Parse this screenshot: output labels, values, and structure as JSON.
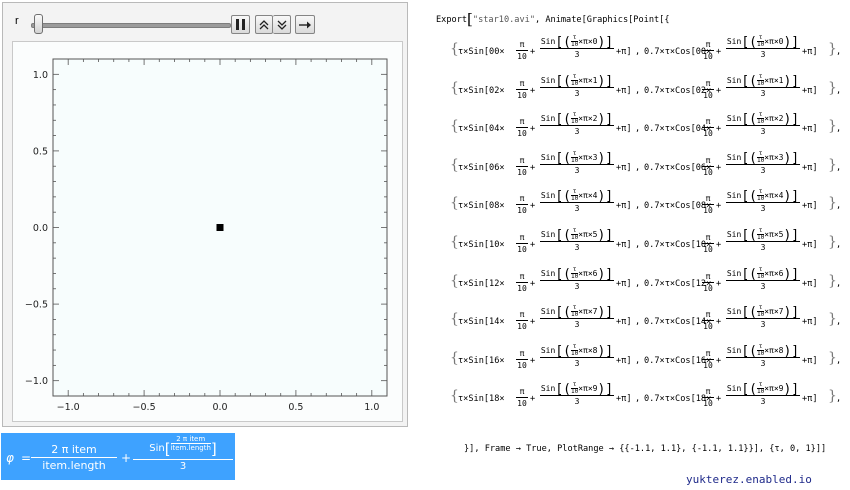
{
  "controls": {
    "label": "r",
    "slider_value": 0,
    "icons": [
      "pause-icon",
      "faster-icon",
      "slower-icon",
      "direction-icon"
    ]
  },
  "plot": {
    "x_ticks": [
      "−1.0",
      "−0.5",
      "0.0",
      "0.5",
      "1.0"
    ],
    "y_ticks": [
      "1.0",
      "0.5",
      "0.0",
      "−0.5",
      "−1.0"
    ],
    "xlim": [
      -1.1,
      1.1
    ],
    "ylim": [
      -1.1,
      1.1
    ],
    "point": [
      0,
      0
    ]
  },
  "phi_formula": {
    "lhs": "φ",
    "eq": "=",
    "num1": "2 π item",
    "den1": "item.length",
    "plus": "+",
    "sin_label": "Sin",
    "inner_num": "2 π item",
    "inner_den": "item.length",
    "den2": "3"
  },
  "code": {
    "head_export": "Export",
    "head_file": "\"star10.avi\"",
    "head_rest": ", Animate[Graphics[Point[{",
    "rows": [
      {
        "k": "00",
        "i": "0"
      },
      {
        "k": "02",
        "i": "1"
      },
      {
        "k": "04",
        "i": "2"
      },
      {
        "k": "06",
        "i": "3"
      },
      {
        "k": "08",
        "i": "4"
      },
      {
        "k": "10",
        "i": "5"
      },
      {
        "k": "12",
        "i": "6"
      },
      {
        "k": "14",
        "i": "7"
      },
      {
        "k": "16",
        "i": "8"
      },
      {
        "k": "18",
        "i": "9"
      }
    ],
    "tail": "}], Frame → True,   PlotRange → {{-1.1, 1.1}, {-1.1, 1.1}}],      {τ, 0, 1}]]"
  },
  "footer": "yukterez.enabled.io"
}
